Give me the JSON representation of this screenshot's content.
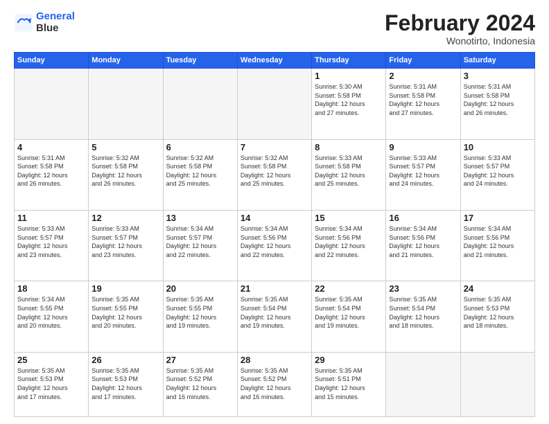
{
  "header": {
    "logo_line1": "General",
    "logo_line2": "Blue",
    "month_year": "February 2024",
    "location": "Wonotirto, Indonesia"
  },
  "days_of_week": [
    "Sunday",
    "Monday",
    "Tuesday",
    "Wednesday",
    "Thursday",
    "Friday",
    "Saturday"
  ],
  "weeks": [
    [
      {
        "day": "",
        "info": ""
      },
      {
        "day": "",
        "info": ""
      },
      {
        "day": "",
        "info": ""
      },
      {
        "day": "",
        "info": ""
      },
      {
        "day": "1",
        "info": "Sunrise: 5:30 AM\nSunset: 5:58 PM\nDaylight: 12 hours\nand 27 minutes."
      },
      {
        "day": "2",
        "info": "Sunrise: 5:31 AM\nSunset: 5:58 PM\nDaylight: 12 hours\nand 27 minutes."
      },
      {
        "day": "3",
        "info": "Sunrise: 5:31 AM\nSunset: 5:58 PM\nDaylight: 12 hours\nand 26 minutes."
      }
    ],
    [
      {
        "day": "4",
        "info": "Sunrise: 5:31 AM\nSunset: 5:58 PM\nDaylight: 12 hours\nand 26 minutes."
      },
      {
        "day": "5",
        "info": "Sunrise: 5:32 AM\nSunset: 5:58 PM\nDaylight: 12 hours\nand 26 minutes."
      },
      {
        "day": "6",
        "info": "Sunrise: 5:32 AM\nSunset: 5:58 PM\nDaylight: 12 hours\nand 25 minutes."
      },
      {
        "day": "7",
        "info": "Sunrise: 5:32 AM\nSunset: 5:58 PM\nDaylight: 12 hours\nand 25 minutes."
      },
      {
        "day": "8",
        "info": "Sunrise: 5:33 AM\nSunset: 5:58 PM\nDaylight: 12 hours\nand 25 minutes."
      },
      {
        "day": "9",
        "info": "Sunrise: 5:33 AM\nSunset: 5:57 PM\nDaylight: 12 hours\nand 24 minutes."
      },
      {
        "day": "10",
        "info": "Sunrise: 5:33 AM\nSunset: 5:57 PM\nDaylight: 12 hours\nand 24 minutes."
      }
    ],
    [
      {
        "day": "11",
        "info": "Sunrise: 5:33 AM\nSunset: 5:57 PM\nDaylight: 12 hours\nand 23 minutes."
      },
      {
        "day": "12",
        "info": "Sunrise: 5:33 AM\nSunset: 5:57 PM\nDaylight: 12 hours\nand 23 minutes."
      },
      {
        "day": "13",
        "info": "Sunrise: 5:34 AM\nSunset: 5:57 PM\nDaylight: 12 hours\nand 22 minutes."
      },
      {
        "day": "14",
        "info": "Sunrise: 5:34 AM\nSunset: 5:56 PM\nDaylight: 12 hours\nand 22 minutes."
      },
      {
        "day": "15",
        "info": "Sunrise: 5:34 AM\nSunset: 5:56 PM\nDaylight: 12 hours\nand 22 minutes."
      },
      {
        "day": "16",
        "info": "Sunrise: 5:34 AM\nSunset: 5:56 PM\nDaylight: 12 hours\nand 21 minutes."
      },
      {
        "day": "17",
        "info": "Sunrise: 5:34 AM\nSunset: 5:56 PM\nDaylight: 12 hours\nand 21 minutes."
      }
    ],
    [
      {
        "day": "18",
        "info": "Sunrise: 5:34 AM\nSunset: 5:55 PM\nDaylight: 12 hours\nand 20 minutes."
      },
      {
        "day": "19",
        "info": "Sunrise: 5:35 AM\nSunset: 5:55 PM\nDaylight: 12 hours\nand 20 minutes."
      },
      {
        "day": "20",
        "info": "Sunrise: 5:35 AM\nSunset: 5:55 PM\nDaylight: 12 hours\nand 19 minutes."
      },
      {
        "day": "21",
        "info": "Sunrise: 5:35 AM\nSunset: 5:54 PM\nDaylight: 12 hours\nand 19 minutes."
      },
      {
        "day": "22",
        "info": "Sunrise: 5:35 AM\nSunset: 5:54 PM\nDaylight: 12 hours\nand 19 minutes."
      },
      {
        "day": "23",
        "info": "Sunrise: 5:35 AM\nSunset: 5:54 PM\nDaylight: 12 hours\nand 18 minutes."
      },
      {
        "day": "24",
        "info": "Sunrise: 5:35 AM\nSunset: 5:53 PM\nDaylight: 12 hours\nand 18 minutes."
      }
    ],
    [
      {
        "day": "25",
        "info": "Sunrise: 5:35 AM\nSunset: 5:53 PM\nDaylight: 12 hours\nand 17 minutes."
      },
      {
        "day": "26",
        "info": "Sunrise: 5:35 AM\nSunset: 5:53 PM\nDaylight: 12 hours\nand 17 minutes."
      },
      {
        "day": "27",
        "info": "Sunrise: 5:35 AM\nSunset: 5:52 PM\nDaylight: 12 hours\nand 16 minutes."
      },
      {
        "day": "28",
        "info": "Sunrise: 5:35 AM\nSunset: 5:52 PM\nDaylight: 12 hours\nand 16 minutes."
      },
      {
        "day": "29",
        "info": "Sunrise: 5:35 AM\nSunset: 5:51 PM\nDaylight: 12 hours\nand 15 minutes."
      },
      {
        "day": "",
        "info": ""
      },
      {
        "day": "",
        "info": ""
      }
    ]
  ]
}
